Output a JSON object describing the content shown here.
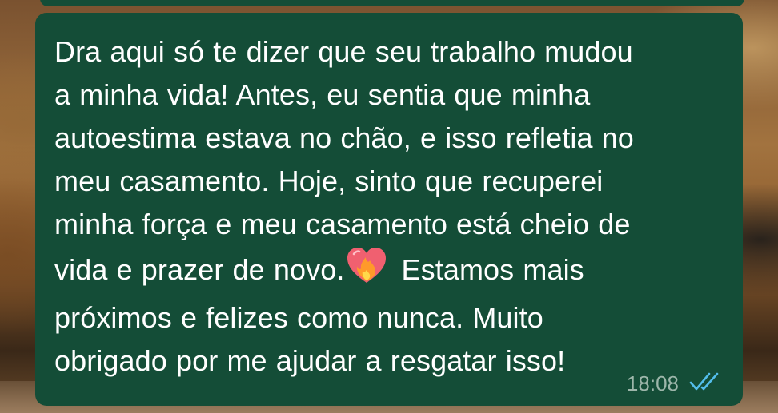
{
  "message": {
    "lines": [
      "Dra aqui  só te dizer que seu trabalho mudou",
      "a minha vida! Antes, eu sentia que minha",
      "autoestima estava no chão, e isso refletia no",
      "meu casamento. Hoje, sinto que recuperei",
      "minha força e meu casamento está cheio de",
      "vida e prazer de novo.",
      " Estamos mais",
      "próximos e felizes como nunca. Muito",
      "obrigado por me ajudar a resgatar isso!"
    ],
    "emoji_icon": "heart-on-fire-icon",
    "time": "18:08",
    "status_icon": "double-check-read-icon"
  },
  "colors": {
    "bubble": "#144d37",
    "text": "#ffffff",
    "timestamp": "#9db6aa",
    "read_ticks": "#53bdeb"
  }
}
